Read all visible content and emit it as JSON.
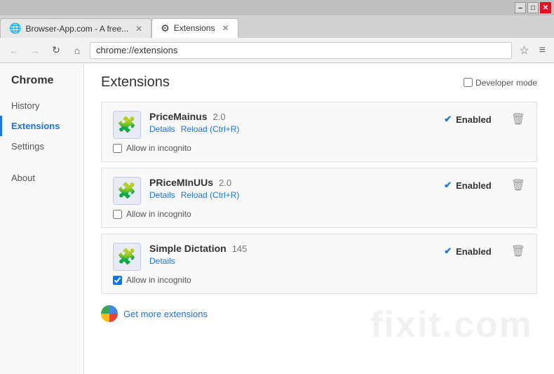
{
  "titlebar": {
    "minimize_label": "–",
    "maximize_label": "□",
    "close_label": "✕"
  },
  "tabs": [
    {
      "id": "tab1",
      "icon": "🌐",
      "label": "Browser-App.com - A free...",
      "active": false,
      "closable": true
    },
    {
      "id": "tab2",
      "icon": "⚙",
      "label": "Extensions",
      "active": true,
      "closable": true
    }
  ],
  "addressbar": {
    "back_label": "←",
    "forward_label": "→",
    "reload_label": "↻",
    "home_label": "⌂",
    "url": "chrome://extensions",
    "star_label": "☆",
    "menu_label": "≡"
  },
  "sidebar": {
    "title": "Chrome",
    "items": [
      {
        "id": "history",
        "label": "History",
        "active": false
      },
      {
        "id": "extensions",
        "label": "Extensions",
        "active": true
      },
      {
        "id": "settings",
        "label": "Settings",
        "active": false
      }
    ],
    "about_label": "About"
  },
  "content": {
    "title": "Extensions",
    "dev_mode_label": "Developer mode",
    "extensions": [
      {
        "id": "pricemainus",
        "name": "PriceMainus",
        "version": "2.0",
        "details_label": "Details",
        "reload_label": "Reload (Ctrl+R)",
        "enabled": true,
        "enabled_label": "Enabled",
        "allow_incognito_label": "Allow in incognito",
        "allow_incognito_checked": false
      },
      {
        "id": "priceminuus",
        "name": "PRiceMInUUs",
        "version": "2.0",
        "details_label": "Details",
        "reload_label": "Reload (Ctrl+R)",
        "enabled": true,
        "enabled_label": "Enabled",
        "allow_incognito_label": "Allow in incognito",
        "allow_incognito_checked": false
      },
      {
        "id": "simpledictation",
        "name": "Simple Dictation",
        "version": "145",
        "details_label": "Details",
        "reload_label": null,
        "enabled": true,
        "enabled_label": "Enabled",
        "allow_incognito_label": "Allow in incognito",
        "allow_incognito_checked": true
      }
    ],
    "get_more_label": "Get more extensions"
  }
}
